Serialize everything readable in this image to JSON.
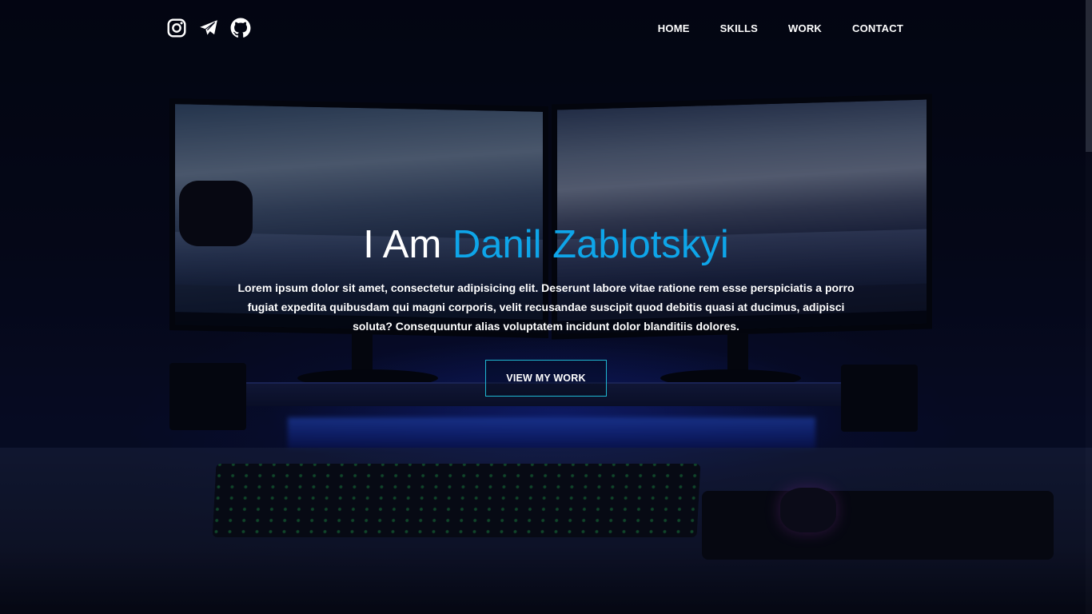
{
  "header": {
    "socials": [
      {
        "icon": "instagram-icon",
        "label": "Instagram"
      },
      {
        "icon": "telegram-icon",
        "label": "Telegram"
      },
      {
        "icon": "github-icon",
        "label": "GitHub"
      }
    ],
    "nav": [
      {
        "label": "HOME"
      },
      {
        "label": "SKILLS"
      },
      {
        "label": "WORK"
      },
      {
        "label": "CONTACT"
      }
    ]
  },
  "hero": {
    "greeting": "I Am",
    "name": "Danil Zablotskyi",
    "intro": "Lorem ipsum dolor sit amet, consectetur adipisicing elit. Deserunt labore vitae ratione rem esse perspiciatis a porro fugiat expedita quibusdam qui magni corporis, velit recusandae suscipit quod debitis quasi at ducimus, adipisci soluta? Consequuntur alias voluptatem incidunt dolor blanditiis dolores.",
    "cta_label": "VIEW MY WORK"
  },
  "colors": {
    "accent": "#0ea5e9",
    "button_border": "#1fb7d2",
    "background": "#05081a",
    "text": "#ffffff"
  }
}
